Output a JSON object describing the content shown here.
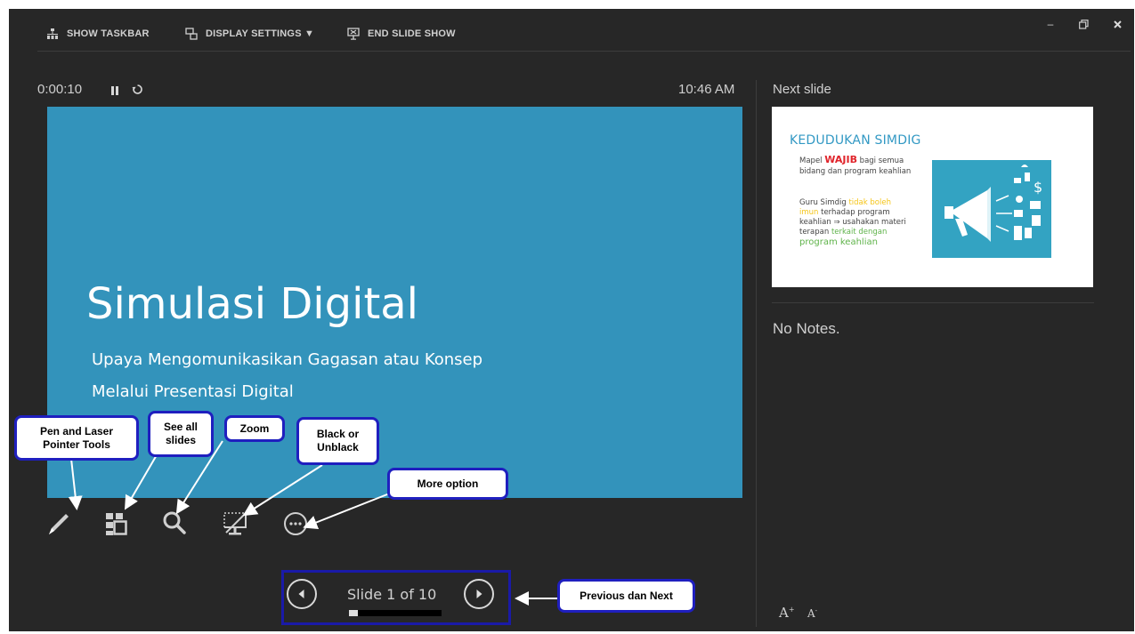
{
  "toolbar": {
    "show_taskbar": "SHOW TASKBAR",
    "display_settings": "DISPLAY SETTINGS ▼",
    "end_slide_show": "END SLIDE SHOW"
  },
  "window_controls": {
    "minimize": "–",
    "restore": "🗗",
    "close": "✕"
  },
  "timer": {
    "elapsed": "0:00:10",
    "clock": "10:46 AM"
  },
  "current_slide": {
    "title": "Simulasi Digital",
    "subtitle_line1": "Upaya Mengomunikasikan Gagasan atau Konsep",
    "subtitle_line2": "Melalui Presentasi Digital",
    "background_color": "#3393bb"
  },
  "tools": [
    {
      "name": "pen-laser-pointer",
      "icon": "pen-icon"
    },
    {
      "name": "see-all-slides",
      "icon": "grid-icon"
    },
    {
      "name": "zoom",
      "icon": "magnifier-icon"
    },
    {
      "name": "black-unblack",
      "icon": "screen-off-icon"
    },
    {
      "name": "more-options",
      "icon": "ellipsis-icon"
    }
  ],
  "callouts": {
    "pen": "Pen and Laser Pointer Tools",
    "see_all": "See all slides",
    "zoom": "Zoom",
    "black": "Black or Unblack",
    "more": "More option",
    "prev_next": "Previous dan Next"
  },
  "navigation": {
    "counter": "Slide 1 of 10",
    "current": 1,
    "total": 10,
    "progress": 0.1
  },
  "next_slide_panel": {
    "label": "Next slide",
    "title": "KEDUDUKAN SIMDIG",
    "line1_pre": "Mapel ",
    "line1_bold": "WAJIB",
    "line1_post": " bagi semua",
    "line2": "bidang dan program keahlian",
    "line3_pre": "Guru Simdig ",
    "line3_hl": "tidak boleh",
    "line4_hl": "imun",
    "line4_post": " terhadap program",
    "line5": "keahlian ⇒ usahakan materi",
    "line6_pre": "terapan ",
    "line6_hl": "terkait dengan",
    "line7_hl": "program keahlian"
  },
  "notes": {
    "text": "No Notes."
  },
  "font_controls": {
    "increase": "A",
    "decrease": "A"
  },
  "colors": {
    "background": "#272727",
    "accent_blue": "#1f1fbf",
    "slide_blue": "#3393bb"
  }
}
